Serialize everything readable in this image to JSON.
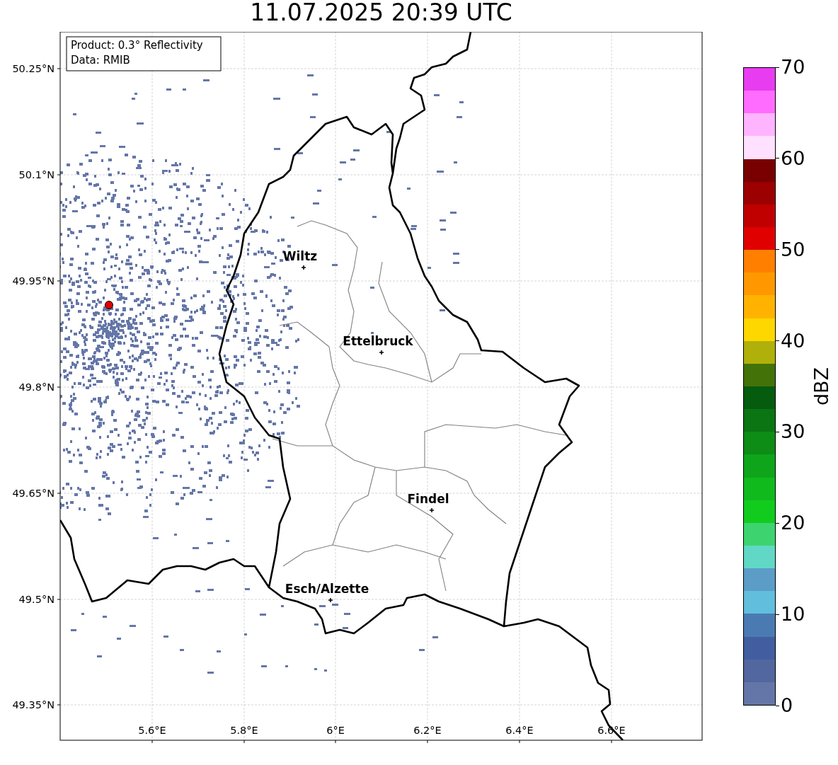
{
  "title": "11.07.2025 20:39 UTC",
  "info_box": [
    "Product: 0.3° Reflectivity",
    "Data: RMIB"
  ],
  "map": {
    "y_ticks": [
      "50.25°N",
      "50.1°N",
      "49.95°N",
      "49.8°N",
      "49.65°N",
      "49.5°N",
      "49.35°N"
    ],
    "x_ticks": [
      "5.6°E",
      "5.8°E",
      "6°E",
      "6.2°E",
      "6.4°E",
      "6.6°E"
    ],
    "cities": [
      {
        "name": "Wiltz"
      },
      {
        "name": "Ettelbruck"
      },
      {
        "name": "Findel"
      },
      {
        "name": "Esch/Alzette"
      }
    ]
  },
  "colorbar": {
    "label": "dBZ",
    "ticks": [
      "70",
      "60",
      "50",
      "40",
      "30",
      "20",
      "10",
      "0"
    ],
    "segments": [
      {
        "color": "#e83cf0"
      },
      {
        "color": "#ff6cff"
      },
      {
        "color": "#ffb4ff"
      },
      {
        "color": "#ffe0ff"
      },
      {
        "color": "#780000"
      },
      {
        "color": "#9c0000"
      },
      {
        "color": "#c00000"
      },
      {
        "color": "#e00000"
      },
      {
        "color": "#ff7f00"
      },
      {
        "color": "#ff9800"
      },
      {
        "color": "#ffb300"
      },
      {
        "color": "#ffd700"
      },
      {
        "color": "#b0b00a"
      },
      {
        "color": "#437209"
      },
      {
        "color": "#055b0e"
      },
      {
        "color": "#0a7512"
      },
      {
        "color": "#0d8c16"
      },
      {
        "color": "#0fa51a"
      },
      {
        "color": "#10ba1c"
      },
      {
        "color": "#11cc1d"
      },
      {
        "color": "#3dd46f"
      },
      {
        "color": "#61d8c6"
      },
      {
        "color": "#5b9dc7"
      },
      {
        "color": "#62bedd"
      },
      {
        "color": "#4a7ab2"
      },
      {
        "color": "#425ea0"
      },
      {
        "color": "#52679f"
      },
      {
        "color": "#6476a8"
      }
    ]
  }
}
